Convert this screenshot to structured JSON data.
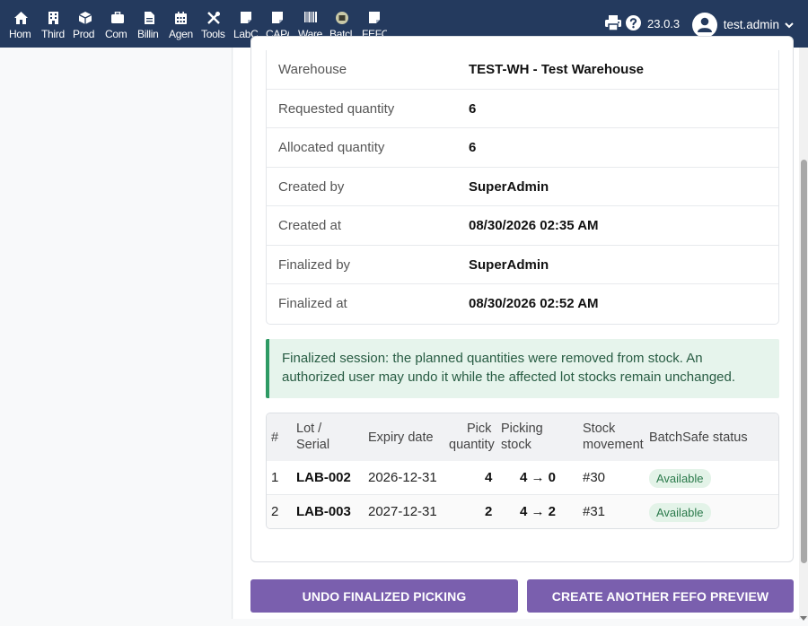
{
  "nav": {
    "items": [
      {
        "label": "Hom",
        "icon": "home-icon"
      },
      {
        "label": "Third",
        "icon": "building-icon"
      },
      {
        "label": "Prod",
        "icon": "cube-icon"
      },
      {
        "label": "Com",
        "icon": "briefcase-icon"
      },
      {
        "label": "Billin",
        "icon": "invoice-icon"
      },
      {
        "label": "Agen",
        "icon": "calendar-icon"
      },
      {
        "label": "Tools",
        "icon": "tools-icon"
      },
      {
        "label": "LabC",
        "icon": "document-icon"
      },
      {
        "label": "CAPA",
        "icon": "document-icon"
      },
      {
        "label": "Ware",
        "icon": "barcode-icon"
      },
      {
        "label": "Batcl",
        "icon": "batch-icon"
      },
      {
        "label": "FEFO",
        "icon": "document-icon"
      }
    ],
    "active_index": 11
  },
  "header": {
    "version": "23.0.3",
    "user": "test.admin"
  },
  "details": [
    {
      "label": "Warehouse",
      "value": "TEST-WH - Test Warehouse"
    },
    {
      "label": "Requested quantity",
      "value": "6"
    },
    {
      "label": "Allocated quantity",
      "value": "6"
    },
    {
      "label": "Created by",
      "value": "SuperAdmin"
    },
    {
      "label": "Created at",
      "value": "08/30/2026 02:35 AM"
    },
    {
      "label": "Finalized by",
      "value": "SuperAdmin"
    },
    {
      "label": "Finalized at",
      "value": "08/30/2026 02:52 AM"
    }
  ],
  "alert": {
    "text": "Finalized session: the planned quantities were removed from stock. An authorized user may undo it while the affected lot stocks remain unchanged."
  },
  "lots": {
    "headers": {
      "num": "#",
      "lot_1": "Lot /",
      "lot_2": "Serial",
      "expiry": "Expiry date",
      "pick_1": "Pick",
      "pick_2": "quantity",
      "picking_1": "Picking",
      "picking_2": "stock",
      "movement_1": "Stock",
      "movement_2": "movement",
      "status": "BatchSafe status"
    },
    "rows": [
      {
        "num": "1",
        "lot": "LAB-002",
        "expiry": "2026-12-31",
        "pick": "4",
        "stock": "4 → 0",
        "movement": "#30",
        "status": "Available"
      },
      {
        "num": "2",
        "lot": "LAB-003",
        "expiry": "2027-12-31",
        "pick": "2",
        "stock": "4 → 2",
        "movement": "#31",
        "status": "Available"
      }
    ]
  },
  "actions": {
    "undo": "UNDO FINALIZED PICKING",
    "create": "CREATE ANOTHER FEFO PREVIEW"
  },
  "colors": {
    "topbar": "#243a5e",
    "accent_button": "#7a5fae",
    "alert_bg": "#e6f4ec",
    "alert_border": "#2e9a64",
    "badge_bg": "#e3f3e8"
  }
}
